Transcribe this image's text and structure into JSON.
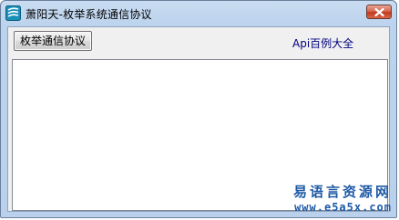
{
  "window": {
    "title": "萧阳天-枚举系统通信协议",
    "icon": "app-logo-icon",
    "close_icon": "close-icon"
  },
  "toolbar": {
    "enum_button_label": "枚举通信协议",
    "api_link_label": "Api百例大全"
  },
  "output": {
    "value": ""
  },
  "watermark": {
    "line1": "易语言资源网",
    "line2": "www.e5a5x.com"
  },
  "colors": {
    "accent": "#1f5aa6",
    "link": "#000080",
    "close_button": "#c2391c"
  }
}
